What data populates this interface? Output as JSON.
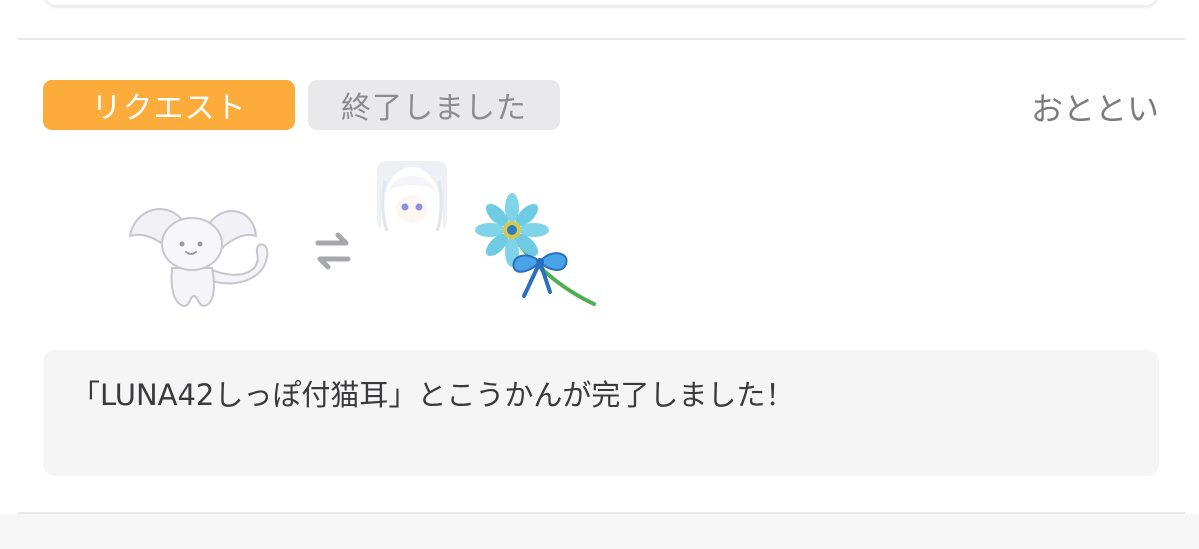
{
  "notification": {
    "request_badge": "リクエスト",
    "status_badge": "終了しました",
    "timestamp": "おととい",
    "message": "「LUNA42しっぽ付猫耳」とこうかんが完了しました！",
    "icons": {
      "given_item": "white-cat-ears-tail-icon",
      "swap": "swap-arrows-icon",
      "partner_avatar": "user-avatar",
      "received_item": "blue-flower-ribbon-icon"
    }
  },
  "colors": {
    "request_badge_bg": "#fbac3a",
    "status_badge_bg": "#e9e9eb",
    "message_bg": "#f5f5f6"
  }
}
